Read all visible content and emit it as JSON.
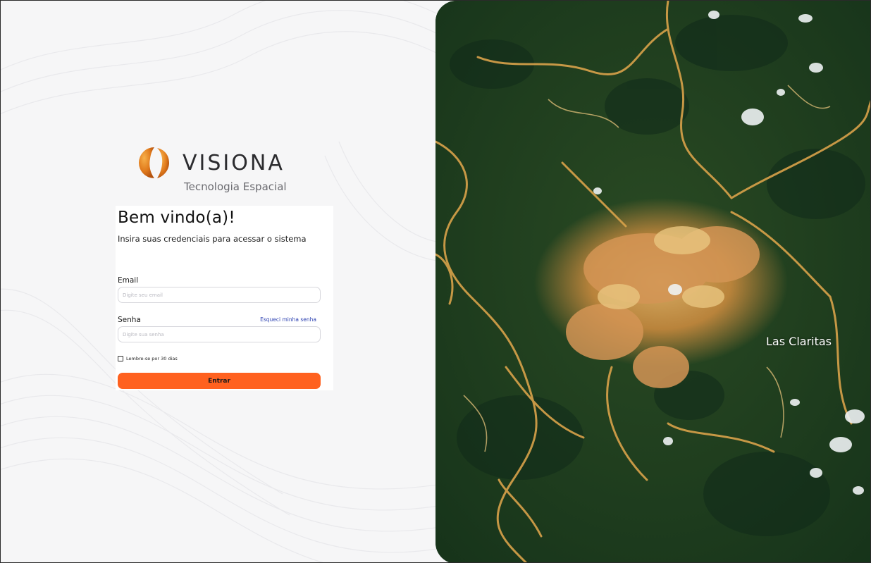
{
  "brand": {
    "name": "VISIONA",
    "tagline": "Tecnologia Espacial"
  },
  "login": {
    "title": "Bem vindo(a)!",
    "subtitle": "Insira suas credenciais para acessar o sistema",
    "email_label": "Email",
    "email_placeholder": "Digite seu email",
    "password_label": "Senha",
    "password_placeholder": "Digite sua senha",
    "forgot_link": "Esqueci minha senha",
    "remember_label": "Lembre-se por 30 dias",
    "remember_checked": false,
    "submit_label": "Entrar"
  },
  "map": {
    "place_label": "Las Claritas"
  },
  "colors": {
    "accent": "#ff611f",
    "link": "#2a3fb0",
    "forest": "#1b3a1c",
    "mining": "#d9a24a"
  }
}
